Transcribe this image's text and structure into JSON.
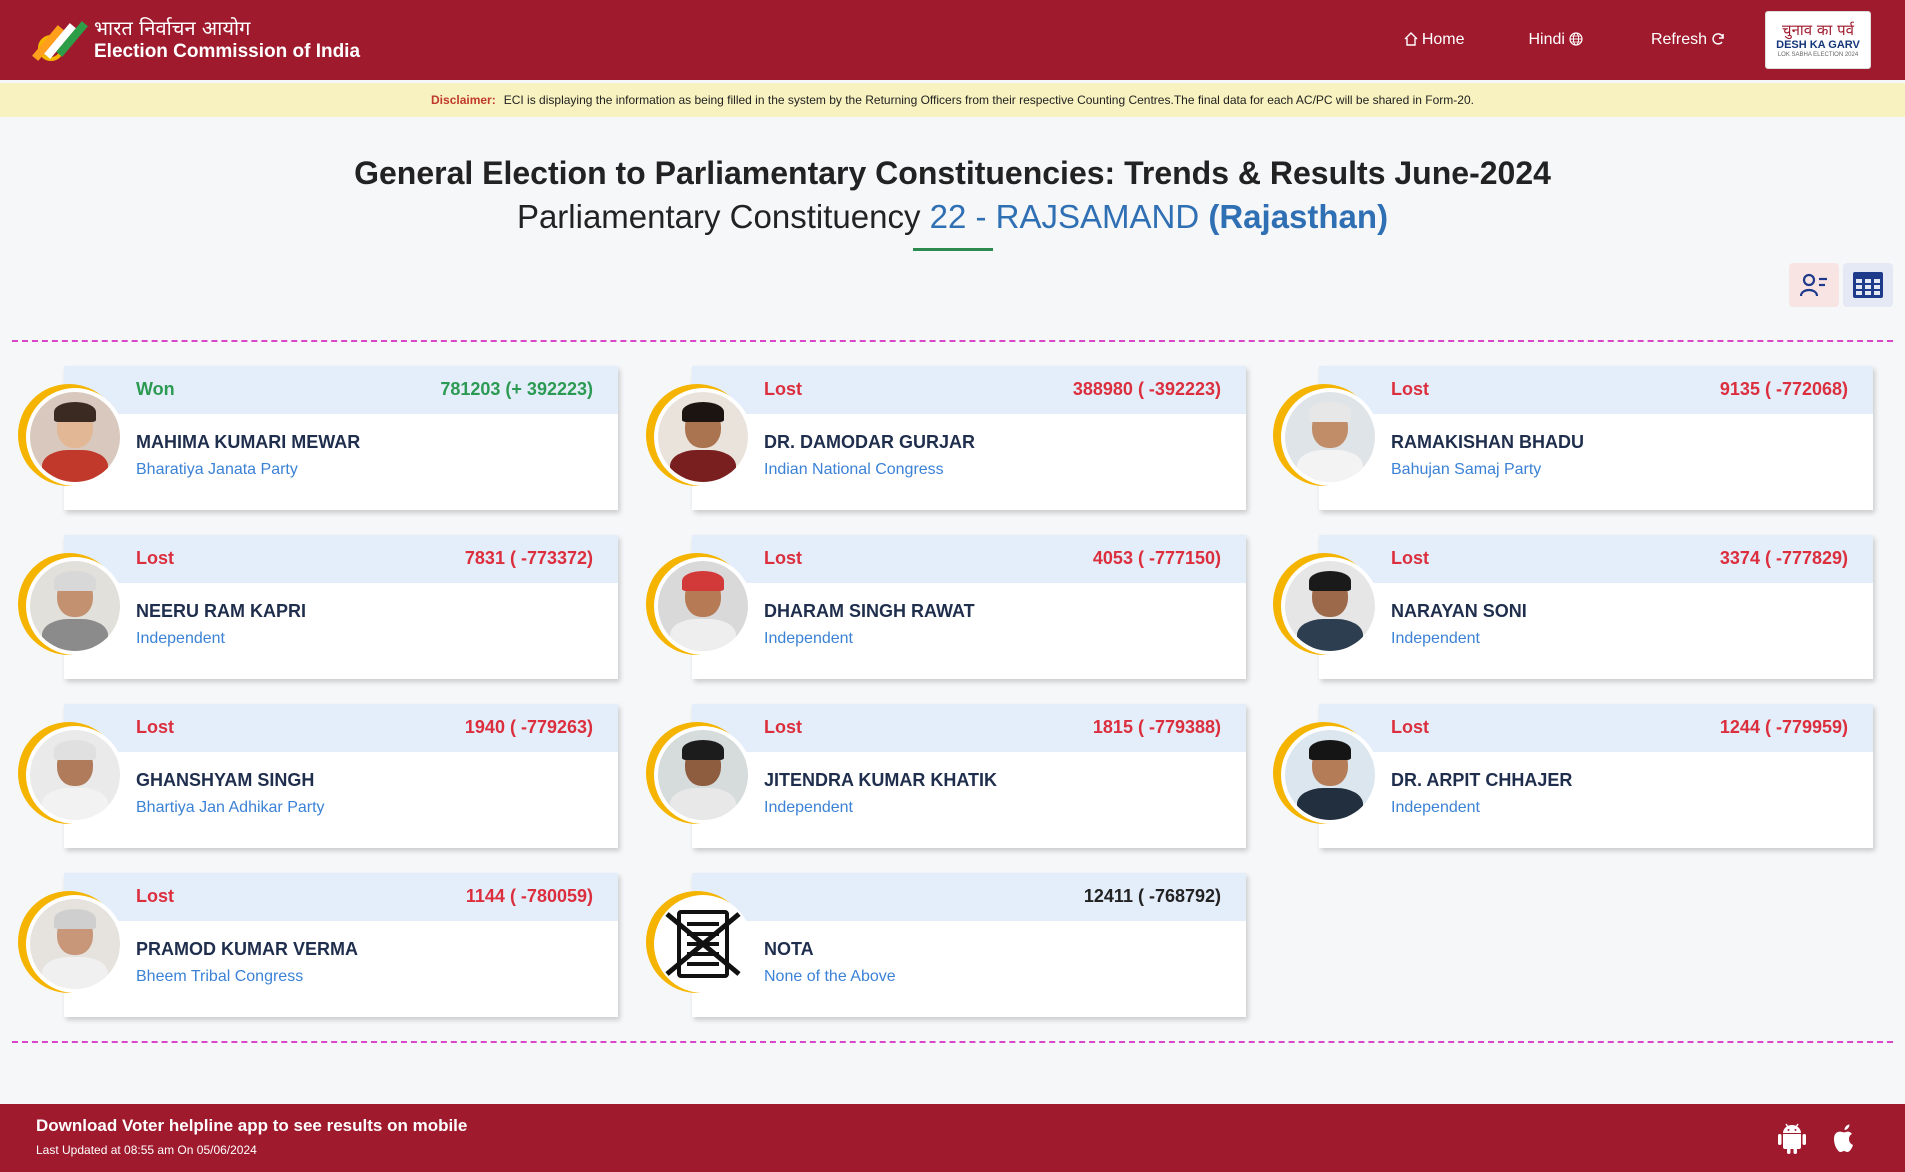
{
  "header": {
    "brand_hindi": "भारत निर्वाचन आयोग",
    "brand_english": "Election Commission of India",
    "nav": [
      {
        "label": "Home",
        "icon": "home-icon"
      },
      {
        "label": "Hindi",
        "icon": "globe-icon"
      },
      {
        "label": "Refresh",
        "icon": "refresh-icon"
      }
    ],
    "badge_hindi": "चुनाव का पर्व",
    "badge_english": "DESH KA GARV",
    "badge_sub": "LOK SABHA ELECTION 2024"
  },
  "disclaimer": {
    "label": "Disclaimer:",
    "text": "ECI is displaying the information as being filled in the system by the Returning Officers from their respective Counting Centres.The final data for each AC/PC will be shared in Form-20."
  },
  "page": {
    "title": "General Election to Parliamentary Constituencies: Trends & Results June-2024",
    "pc_prefix": "Parliamentary Constituency",
    "pc_name": "22 - RAJSAMAND",
    "state": "(Rajasthan)"
  },
  "candidates": [
    {
      "status": "Won",
      "votes": "781203 (+ 392223)",
      "name": "MAHIMA KUMARI MEWAR",
      "party": "Bharatiya Janata Party"
    },
    {
      "status": "Lost",
      "votes": "388980 ( -392223)",
      "name": "DR. DAMODAR GURJAR",
      "party": "Indian National Congress"
    },
    {
      "status": "Lost",
      "votes": "9135 ( -772068)",
      "name": "RAMAKISHAN BHADU",
      "party": "Bahujan Samaj Party"
    },
    {
      "status": "Lost",
      "votes": "7831 ( -773372)",
      "name": "NEERU RAM KAPRI",
      "party": "Independent"
    },
    {
      "status": "Lost",
      "votes": "4053 ( -777150)",
      "name": "DHARAM SINGH RAWAT",
      "party": "Independent"
    },
    {
      "status": "Lost",
      "votes": "3374 ( -777829)",
      "name": "NARAYAN SONI",
      "party": "Independent"
    },
    {
      "status": "Lost",
      "votes": "1940 ( -779263)",
      "name": "GHANSHYAM SINGH",
      "party": "Bhartiya Jan Adhikar Party"
    },
    {
      "status": "Lost",
      "votes": "1815 ( -779388)",
      "name": "JITENDRA KUMAR KHATIK",
      "party": "Independent"
    },
    {
      "status": "Lost",
      "votes": "1244 ( -779959)",
      "name": "DR. ARPIT CHHAJER",
      "party": "Independent"
    },
    {
      "status": "Lost",
      "votes": "1144 ( -780059)",
      "name": "PRAMOD KUMAR VERMA",
      "party": "Bheem Tribal Congress"
    },
    {
      "status": "",
      "votes": "12411 ( -768792)",
      "name": "NOTA",
      "party": "None of the Above"
    }
  ],
  "footer": {
    "app_text": "Download Voter helpline app to see results on mobile",
    "updated": "Last Updated at 08:55 am On 05/06/2024"
  },
  "colors": {
    "brand": "#a01a2e",
    "won": "#2c9a53",
    "lost": "#dc2f3e",
    "party": "#3b82d6",
    "ring": "#f5b400"
  }
}
